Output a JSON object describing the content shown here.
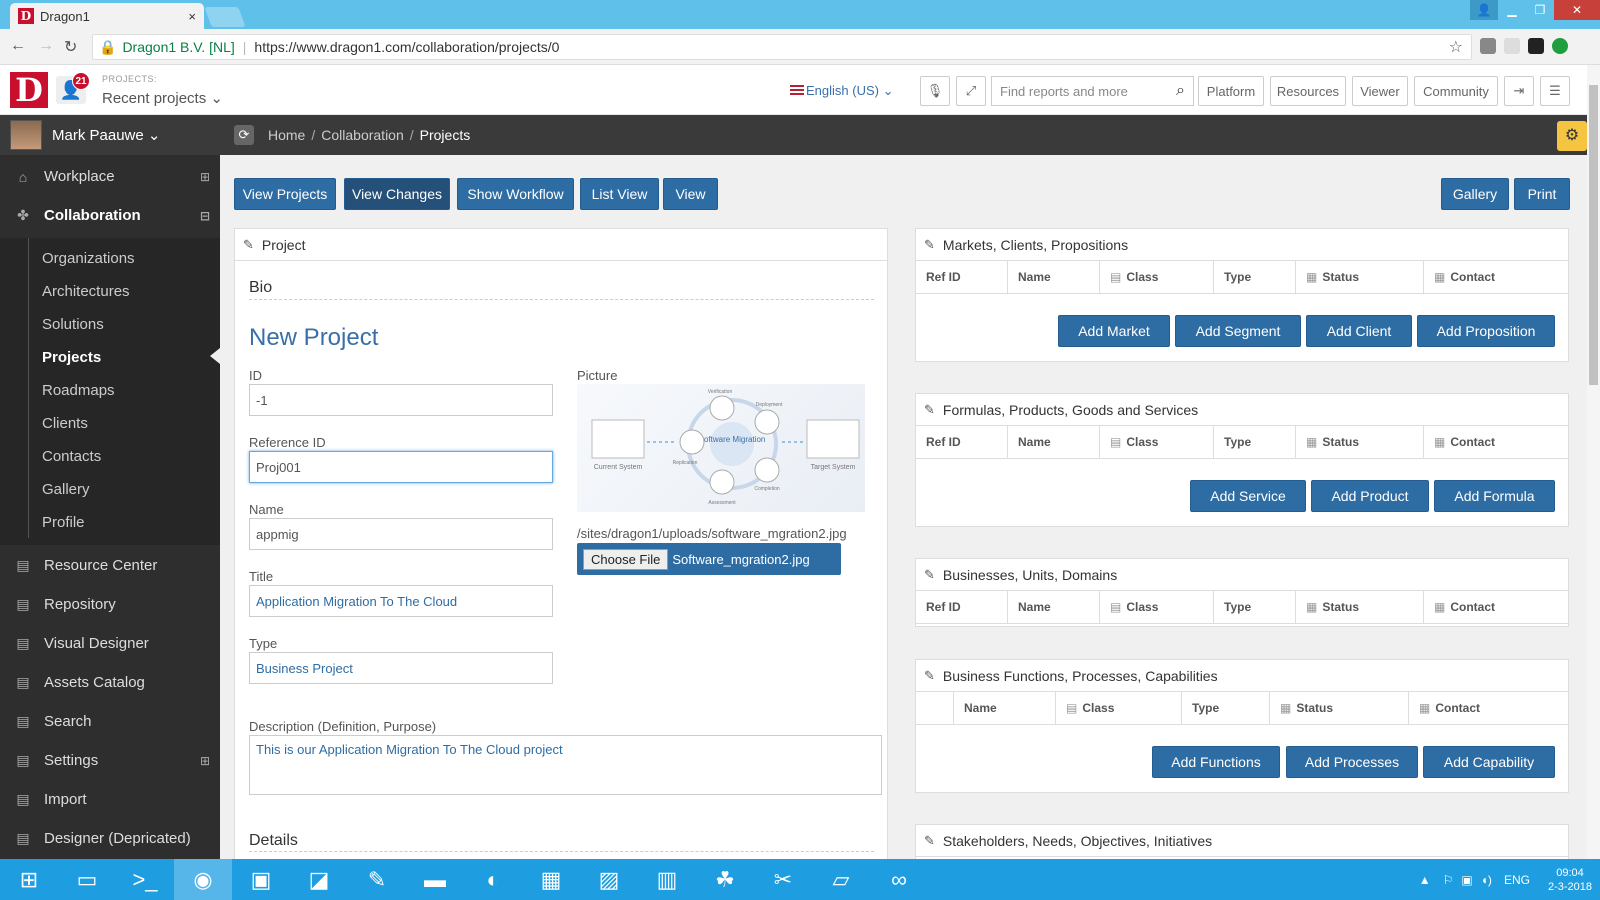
{
  "browser": {
    "tab_title": "Dragon1",
    "tab_close": "×",
    "favicon_letter": "D",
    "org": "Dragon1 B.V. [NL]",
    "url": "https://www.dragon1.com/collaboration/projects/0"
  },
  "header": {
    "logo_letter": "D",
    "notification_count": "21",
    "projects_label": "PROJECTS:",
    "recent_projects": "Recent projects ⌄",
    "language": "English (US) ⌄",
    "search_placeholder": "Find reports and more",
    "nav": [
      "Platform",
      "Resources",
      "Viewer",
      "Community"
    ]
  },
  "sidebar": {
    "user": "Mark Paauwe ⌄",
    "items": [
      {
        "label": "Workplace",
        "icon": "home-icon",
        "toggle": "⊞"
      },
      {
        "label": "Collaboration",
        "icon": "puzzle-icon",
        "toggle": "⊟"
      }
    ],
    "sub_items": [
      "Organizations",
      "Architectures",
      "Solutions",
      "Projects",
      "Roadmaps",
      "Clients",
      "Contacts",
      "Gallery",
      "Profile"
    ],
    "bottom_items": [
      {
        "label": "Resource Center"
      },
      {
        "label": "Repository"
      },
      {
        "label": "Visual Designer"
      },
      {
        "label": "Assets Catalog"
      },
      {
        "label": "Search"
      },
      {
        "label": "Settings",
        "toggle": "⊞"
      },
      {
        "label": "Import"
      },
      {
        "label": "Designer (Depricated)"
      }
    ]
  },
  "breadcrumb": {
    "home": "Home",
    "sep": "/",
    "section": "Collaboration",
    "current": "Projects"
  },
  "toolbar": {
    "buttons": [
      "View Projects",
      "View Changes",
      "Show Workflow",
      "List View",
      "View"
    ],
    "gallery": "Gallery",
    "print": "Print"
  },
  "project": {
    "panel_title": "Project",
    "bio": "Bio",
    "heading": "New Project",
    "id_label": "ID",
    "id_value": "-1",
    "ref_label": "Reference ID",
    "ref_value": "Proj001",
    "name_label": "Name",
    "name_value": "appmig",
    "title_label": "Title",
    "title_value": "Application Migration To The Cloud",
    "type_label": "Type",
    "type_value": "Business Project",
    "picture_label": "Picture",
    "picture_path": "/sites/dragon1/uploads/software_mgration2.jpg",
    "choose_file": "Choose File",
    "file_name": "Software_mgration2.jpg",
    "desc_label": "Description (Definition, Purpose)",
    "desc_value": "This is our Application Migration To The Cloud project",
    "details": "Details",
    "diagram": {
      "center": "Software Migration",
      "current": "Current System",
      "target": "Target System",
      "verification": "Verification",
      "deployment": "Deployment",
      "replication": "Replication",
      "completion": "Completion",
      "assessment": "Assessment"
    }
  },
  "panels": {
    "markets": {
      "title": "Markets, Clients, Propositions",
      "columns": [
        "Ref ID",
        "Name",
        "Class",
        "Type",
        "Status",
        "Contact"
      ],
      "buttons": [
        "Add Market",
        "Add Segment",
        "Add Client",
        "Add Proposition"
      ]
    },
    "formulas": {
      "title": "Formulas, Products, Goods and Services",
      "columns": [
        "Ref ID",
        "Name",
        "Class",
        "Type",
        "Status",
        "Contact"
      ],
      "buttons": [
        "Add Service",
        "Add Product",
        "Add Formula"
      ]
    },
    "businesses": {
      "title": "Businesses, Units, Domains",
      "columns": [
        "Ref ID",
        "Name",
        "Class",
        "Type",
        "Status",
        "Contact"
      ]
    },
    "functions": {
      "title": "Business Functions, Processes, Capabilities",
      "columns": [
        "Name",
        "Class",
        "Type",
        "Status",
        "Contact"
      ],
      "buttons": [
        "Add Functions",
        "Add Processes",
        "Add Capability"
      ]
    },
    "stakeholders": {
      "title": "Stakeholders, Needs, Objectives, Initiatives"
    }
  },
  "taskbar": {
    "lang": "ENG",
    "time": "09:04",
    "date": "2-3-2018"
  }
}
